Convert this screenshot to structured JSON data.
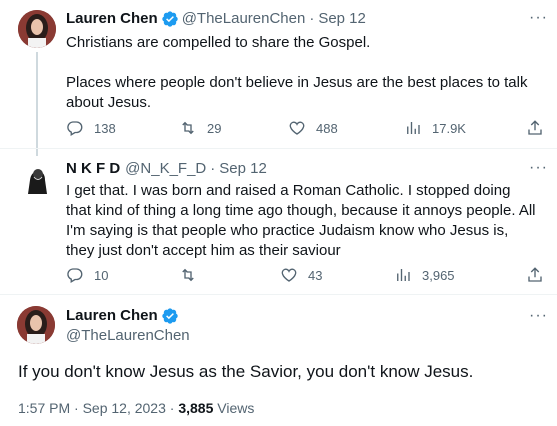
{
  "tweet1": {
    "name": "Lauren Chen",
    "handle": "@TheLaurenChen",
    "sep": "·",
    "date": "Sep 12",
    "line1": "Christians are compelled to share the Gospel.",
    "line2": "Places where people don't believe in Jesus are the best places to talk about Jesus.",
    "replies": "138",
    "retweets": "29",
    "likes": "488",
    "views": "17.9K",
    "more": "···"
  },
  "tweet2": {
    "name": "N K F D",
    "handle": "@N_K_F_D",
    "sep": "·",
    "date": "Sep 12",
    "text": "I get that. I was born and raised a Roman Catholic. I stopped doing that kind of thing a long time ago though, because it annoys people. All I'm saying is that people who practice Judaism know who Jesus is, they just don't accept him as their saviour",
    "replies": "10",
    "retweets": "",
    "likes": "43",
    "views": "3,965",
    "more": "···"
  },
  "tweet3": {
    "name": "Lauren Chen",
    "handle": "@TheLaurenChen",
    "text": "If you don't know Jesus as the Savior, you don't know Jesus.",
    "time": "1:57 PM · Sep 12, 2023 · ",
    "views_count": "3,885",
    "views_label": " Views",
    "more": "···"
  },
  "colors": {
    "accent": "#1d9bf0",
    "muted": "#536471",
    "line": "#cfd9de"
  },
  "icons": [
    "verified-badge-icon",
    "reply-icon",
    "retweet-icon",
    "like-icon",
    "views-icon",
    "share-icon",
    "more-icon"
  ]
}
